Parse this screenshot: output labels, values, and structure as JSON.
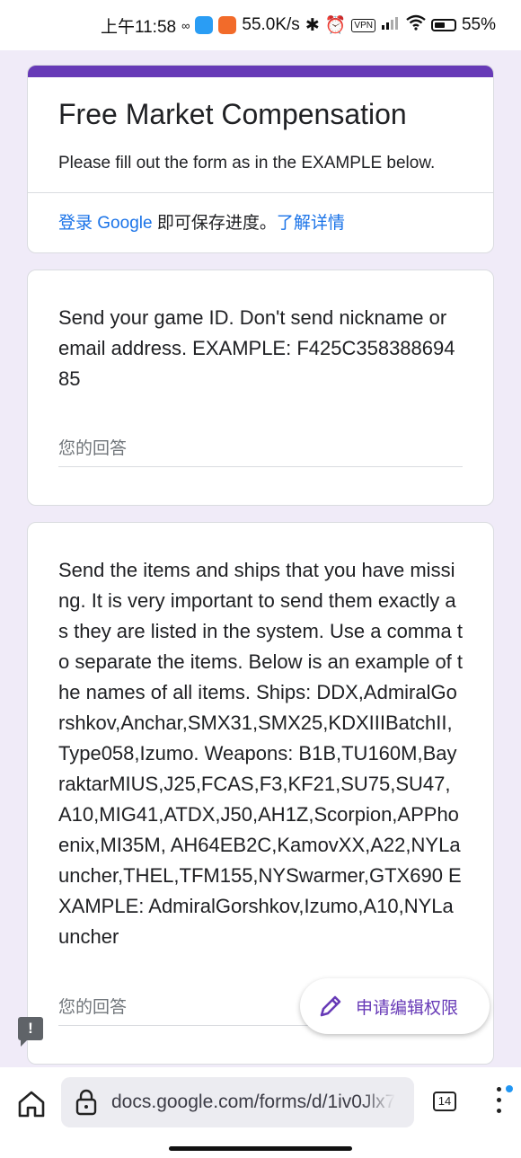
{
  "status_bar": {
    "time": "上午11:58",
    "network_speed": "55.0K/s",
    "vpn": "VPN",
    "battery": "55%",
    "battery_level": 0.55
  },
  "form": {
    "title": "Free Market Compensation",
    "description": "Please fill out the form as in the EXAMPLE below.",
    "signin_link": "登录 Google",
    "signin_text": " 即可保存进度。",
    "learn_more_link": "了解详情"
  },
  "questions": [
    {
      "text": "Send your game ID. Don't send nickname or email address. EXAMPLE: F425C35838869485",
      "answer_placeholder": "您的回答"
    },
    {
      "text": "Send the items and ships that you have missing. It is very important to send them exactly as they are listed in the system. Use a comma to separate the items. Below is an example of the names of all items.  Ships: DDX,AdmiralGorshkov,Anchar,SMX31,SMX25,KDXIIIBatchII,Type058,Izumo. Weapons: B1B,TU160M,BayraktarMIUS,J25,FCAS,F3,KF21,SU75,SU47,A10,MIG41,ATDX,J50,AH1Z,Scorpion,APPhoenix,MI35M,      AH64EB2C,KamovXX,A22,NYLauncher,THEL,TFM155,NYSwarmer,GTX690     EXAMPLE:  AdmiralGorshkov,Izumo,A10,NYLauncher",
      "answer_placeholder": "您的回答"
    }
  ],
  "fab": {
    "label": "申请编辑权限"
  },
  "browser": {
    "url": "docs.google.com/forms/d/1iv0Jlx7",
    "tab_count": "14"
  }
}
